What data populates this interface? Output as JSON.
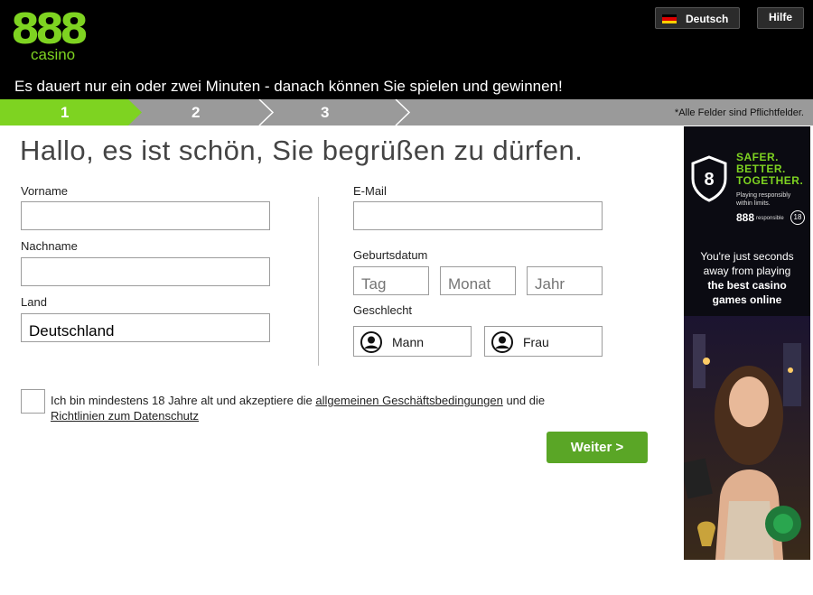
{
  "brand": {
    "logo_number": "888",
    "logo_word": "casino",
    "accent_color": "#7ed321",
    "button_color": "#5aa626"
  },
  "header": {
    "language_label": "Deutsch",
    "help_label": "Hilfe",
    "tagline": "Es dauert nur ein oder zwei Minuten - danach können Sie spielen und gewinnen!"
  },
  "steps": {
    "items": [
      "1",
      "2",
      "3"
    ],
    "active_index": 0,
    "required_note": "*Alle Felder sind Pflichtfelder."
  },
  "form": {
    "heading": "Hallo, es ist schön, Sie begrüßen zu dürfen.",
    "first_name": {
      "label": "Vorname",
      "value": ""
    },
    "last_name": {
      "label": "Nachname",
      "value": ""
    },
    "country": {
      "label": "Land",
      "value": "Deutschland"
    },
    "email": {
      "label": "E-Mail",
      "value": ""
    },
    "birthdate": {
      "label": "Geburtsdatum",
      "day_placeholder": "Tag",
      "month_placeholder": "Monat",
      "year_placeholder": "Jahr"
    },
    "gender": {
      "label": "Geschlecht",
      "male": "Mann",
      "female": "Frau"
    },
    "terms": {
      "text_before": "Ich bin mindestens 18 Jahre alt und akzeptiere die ",
      "link_terms": "allgemeinen Geschäftsbedingungen",
      "text_middle": " und die ",
      "link_privacy": "Richtlinien zum Datenschutz"
    },
    "next_button": "Weiter >"
  },
  "banner": {
    "shield_number": "8",
    "headline_lines": [
      "SAFER.",
      "BETTER.",
      "TOGETHER."
    ],
    "small_lines": [
      "Playing responsibly",
      "within limits."
    ],
    "logo_number": "888",
    "responsible_label": "responsible",
    "age_badge": "18",
    "promo_lines": [
      "You're just seconds",
      "away from playing"
    ],
    "promo_bold_lines": [
      "the best casino",
      "games online"
    ]
  }
}
